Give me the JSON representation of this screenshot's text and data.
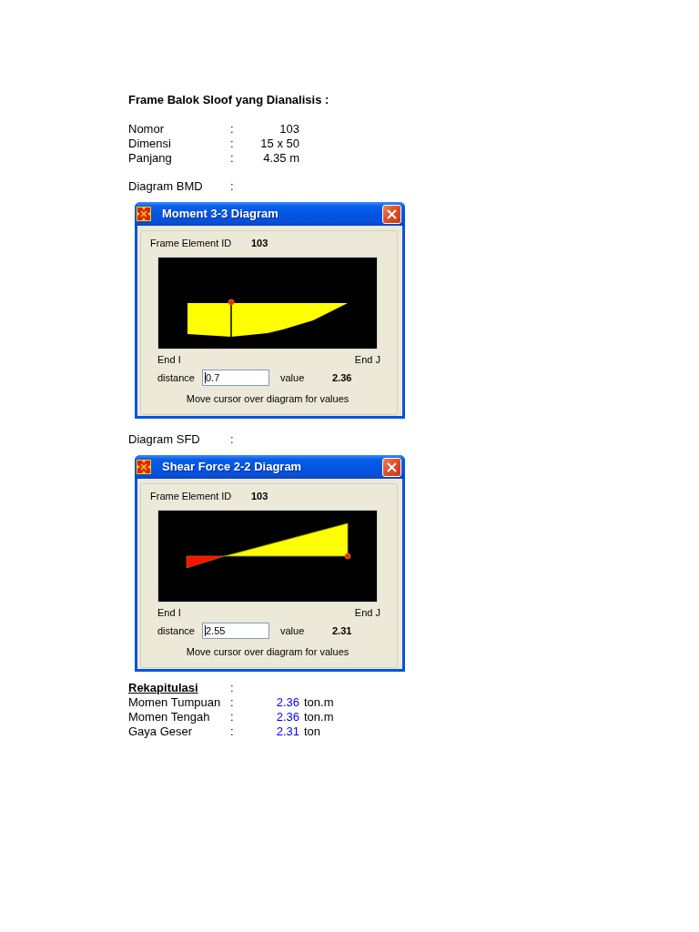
{
  "heading": "Frame Balok Sloof yang Dianalisis :",
  "properties": [
    {
      "label": "Nomor",
      "separator": ":",
      "value": "103"
    },
    {
      "label": "Dimensi",
      "separator": ":",
      "value": "15 x 50"
    },
    {
      "label": "Panjang",
      "separator": ":",
      "value": "4.35 m"
    }
  ],
  "diagrams": [
    {
      "label": "Diagram BMD",
      "separator": ":",
      "dialog": {
        "kind": "moment",
        "title": "Moment 3-3 Diagram",
        "element_id_label": "Frame Element ID",
        "element_id": "103",
        "end_i_label": "End I",
        "end_j_label": "End J",
        "distance_label": "distance",
        "distance": "0.7",
        "value_label": "value",
        "value": "2.36",
        "hint": "Move cursor over diagram for values"
      }
    },
    {
      "label": "Diagram SFD",
      "separator": ":",
      "dialog": {
        "kind": "shear",
        "title": "Shear Force 2-2 Diagram",
        "element_id_label": "Frame Element ID",
        "element_id": "103",
        "end_i_label": "End I",
        "end_j_label": "End J",
        "distance_label": "distance",
        "distance": "2.55",
        "value_label": "value",
        "value": "2.31",
        "hint": "Move cursor over diagram for values"
      }
    }
  ],
  "summary": {
    "heading": "Rekapitulasi",
    "separator": ":",
    "rows": [
      {
        "label": "Momen Tumpuan",
        "separator": ":",
        "value": "2.36",
        "unit": "ton.m"
      },
      {
        "label": "Momen Tengah",
        "separator": ":",
        "value": "2.36",
        "unit": "ton.m"
      },
      {
        "label": "Gaya Geser",
        "separator": ":",
        "value": "2.31",
        "unit": "ton"
      }
    ]
  }
}
